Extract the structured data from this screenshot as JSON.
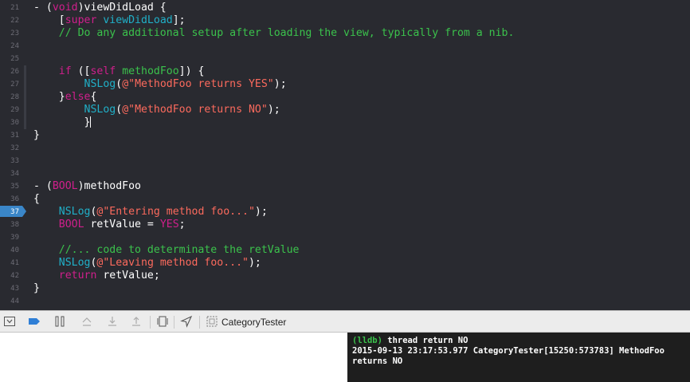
{
  "editor": {
    "line_numbers": [
      "21",
      "22",
      "23",
      "24",
      "25",
      "26",
      "27",
      "28",
      "29",
      "30",
      "31",
      "32",
      "33",
      "34",
      "35",
      "36",
      "37",
      "38",
      "39",
      "40",
      "41",
      "42",
      "43",
      "44"
    ],
    "current_line": "37",
    "lines": {
      "l21": {
        "a": "- (",
        "b": "void",
        "c": ")viewDidLoad {"
      },
      "l22": {
        "a": "    [",
        "b": "super",
        "c": " ",
        "d": "viewDidLoad",
        "e": "];"
      },
      "l23": {
        "a": "    // Do any additional setup after loading the view, typically from a nib."
      },
      "l26": {
        "a": "    ",
        "b": "if",
        "c": " ([",
        "d": "self",
        "e": " ",
        "f": "methodFoo",
        "g": "]) {"
      },
      "l27": {
        "a": "        ",
        "b": "NSLog",
        "c": "(",
        "d": "@\"MethodFoo returns YES\"",
        "e": ");"
      },
      "l28": {
        "a": "    }",
        "b": "else",
        "c": "{"
      },
      "l29": {
        "a": "        ",
        "b": "NSLog",
        "c": "(",
        "d": "@\"MethodFoo returns NO\"",
        "e": ");"
      },
      "l30": {
        "a": "        }"
      },
      "l31": {
        "a": "}"
      },
      "l35": {
        "a": "- (",
        "b": "BOOL",
        "c": ")methodFoo"
      },
      "l36": {
        "a": "{"
      },
      "l37": {
        "a": "    ",
        "b": "NSLog",
        "c": "(",
        "d": "@\"Entering method foo...\"",
        "e": ");"
      },
      "l38": {
        "a": "    ",
        "b": "BOOL",
        "c": " retValue = ",
        "d": "YES",
        "e": ";"
      },
      "l40": {
        "a": "    //... code to determinate the retValue"
      },
      "l41": {
        "a": "    ",
        "b": "NSLog",
        "c": "(",
        "d": "@\"Leaving method foo...\"",
        "e": ");"
      },
      "l42": {
        "a": "    ",
        "b": "return",
        "c": " retValue;"
      },
      "l43": {
        "a": "}"
      }
    }
  },
  "debug_bar": {
    "target_name": "CategoryTester",
    "icons": [
      "hide-debug-area-icon",
      "breakpoints-toggle-icon",
      "pause-continue-icon",
      "step-over-icon",
      "step-into-icon",
      "step-out-icon",
      "debug-view-hierarchy-icon",
      "simulate-location-icon",
      "target-icon"
    ]
  },
  "console": {
    "prompt": "(lldb)",
    "command": " thread return NO",
    "output_line1": "2015-09-13 23:17:53.977 CategoryTester[15250:573783] MethodFoo",
    "output_line2": "returns NO"
  },
  "colors": {
    "background": "#292a30",
    "keyword": "#d01f8c",
    "function": "#20b0c8",
    "string": "#fc6a5d",
    "comment": "#3bc24c",
    "breakpoint": "#3a86c8"
  }
}
